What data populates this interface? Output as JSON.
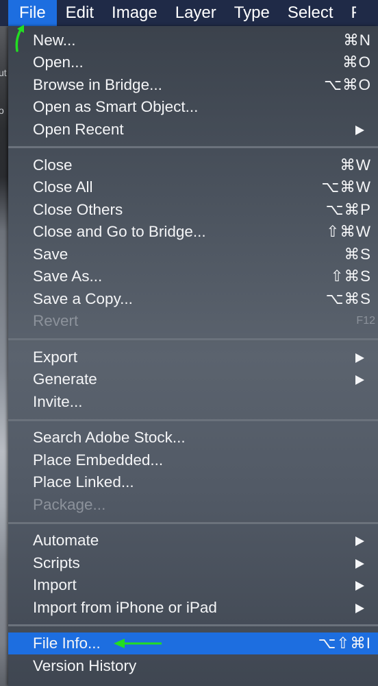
{
  "menubar": {
    "items": [
      "File",
      "Edit",
      "Image",
      "Layer",
      "Type",
      "Select",
      "F"
    ]
  },
  "background": {
    "side_text": [
      "ut",
      "o"
    ]
  },
  "menu": {
    "new": {
      "label": "New...",
      "shortcut": "⌘N"
    },
    "open": {
      "label": "Open...",
      "shortcut": "⌘O"
    },
    "browse": {
      "label": "Browse in Bridge...",
      "shortcut": "⌥⌘O"
    },
    "open_smart": {
      "label": "Open as Smart Object..."
    },
    "open_recent": {
      "label": "Open Recent"
    },
    "close": {
      "label": "Close",
      "shortcut": "⌘W"
    },
    "close_all": {
      "label": "Close All",
      "shortcut": "⌥⌘W"
    },
    "close_others": {
      "label": "Close Others",
      "shortcut": "⌥⌘P"
    },
    "close_bridge": {
      "label": "Close and Go to Bridge...",
      "shortcut": "⇧⌘W"
    },
    "save": {
      "label": "Save",
      "shortcut": "⌘S"
    },
    "save_as": {
      "label": "Save As...",
      "shortcut": "⇧⌘S"
    },
    "save_copy": {
      "label": "Save a Copy...",
      "shortcut": "⌥⌘S"
    },
    "revert": {
      "label": "Revert",
      "shortcut": "F12"
    },
    "export": {
      "label": "Export"
    },
    "generate": {
      "label": "Generate"
    },
    "invite": {
      "label": "Invite..."
    },
    "search_stock": {
      "label": "Search Adobe Stock..."
    },
    "place_embedded": {
      "label": "Place Embedded..."
    },
    "place_linked": {
      "label": "Place Linked..."
    },
    "package": {
      "label": "Package..."
    },
    "automate": {
      "label": "Automate"
    },
    "scripts": {
      "label": "Scripts"
    },
    "import": {
      "label": "Import"
    },
    "import_iphone": {
      "label": "Import from iPhone or iPad"
    },
    "file_info": {
      "label": "File Info...",
      "shortcut": "⌥⇧⌘I"
    },
    "version_history": {
      "label": "Version History"
    }
  },
  "colors": {
    "menubar": "#1f2a47",
    "highlight": "#1d6ee0",
    "annotation_arrow": "#22dd22"
  },
  "icons": {
    "submenu": "submenu-arrow-icon",
    "annotation": "green-annotation-arrow-icon"
  }
}
